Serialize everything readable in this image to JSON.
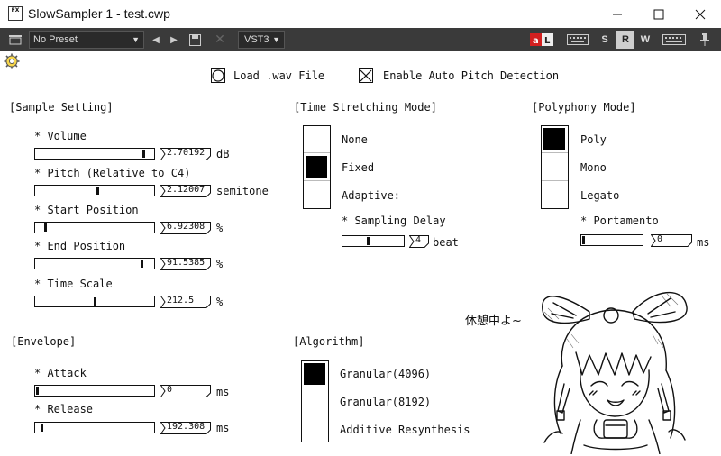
{
  "window": {
    "title": "SlowSampler 1 - test.cwp",
    "icon_text": "FX",
    "minimize": "–",
    "maximize": "☐",
    "close": "✕"
  },
  "toolbar": {
    "preset": "No Preset",
    "plugin_format": "VST3",
    "s": "S",
    "r": "R",
    "w": "W"
  },
  "top": {
    "load_wav": "Load .wav File",
    "auto_pitch": "Enable Auto Pitch Detection",
    "auto_pitch_checked": true
  },
  "sample": {
    "header": "[Sample Setting]",
    "volume_label": "* Volume",
    "volume_value": "2.70192",
    "volume_unit": "dB",
    "volume_level": 0.93,
    "pitch_label": "* Pitch (Relative to C4)",
    "pitch_value": "2.12007",
    "pitch_unit": "semitone",
    "pitch_level": 0.53,
    "start_label": "* Start Position",
    "start_value": "6.92308",
    "start_unit": "%",
    "start_level": 0.07,
    "end_label": "* End Position",
    "end_value": "91.5385",
    "end_unit": "%",
    "end_level": 0.915,
    "scale_label": "* Time Scale",
    "scale_value": "212.5",
    "scale_unit": "%",
    "scale_level": 0.5
  },
  "envelope": {
    "header": "[Envelope]",
    "attack_label": "* Attack",
    "attack_value": "0",
    "attack_unit": "ms",
    "attack_level": 0.0,
    "release_label": "* Release",
    "release_value": "192.308",
    "release_unit": "ms",
    "release_level": 0.04
  },
  "stretch": {
    "header": "[Time Stretching Mode]",
    "options": [
      "None",
      "Fixed",
      "Adaptive:"
    ],
    "selected": 1,
    "delay_label": "* Sampling Delay",
    "delay_value": "4",
    "delay_unit": "beat",
    "delay_level": 0.42
  },
  "algorithm": {
    "header": "[Algorithm]",
    "options": [
      "Granular(4096)",
      "Granular(8192)",
      "Additive Resynthesis"
    ],
    "selected": 0
  },
  "polyphony": {
    "header": "[Polyphony Mode]",
    "options": [
      "Poly",
      "Mono",
      "Legato"
    ],
    "selected": 0,
    "portamento_label": "* Portamento",
    "portamento_value": "0",
    "portamento_unit": "ms",
    "portamento_level": 0.0
  },
  "mascot": {
    "speech": "休憩中よ~"
  }
}
